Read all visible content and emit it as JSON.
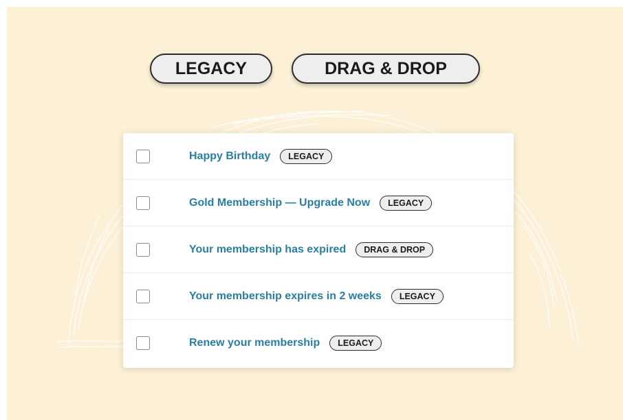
{
  "filters": [
    {
      "label": "LEGACY"
    },
    {
      "label": "DRAG & DROP"
    }
  ],
  "rows": [
    {
      "title": "Happy Birthday",
      "tag": "LEGACY"
    },
    {
      "title": "Gold Membership — Upgrade Now",
      "tag": "LEGACY"
    },
    {
      "title": "Your membership has expired",
      "tag": "DRAG & DROP"
    },
    {
      "title": "Your membership expires in 2 weeks",
      "tag": "LEGACY"
    },
    {
      "title": "Renew your membership",
      "tag": "LEGACY"
    }
  ],
  "colors": {
    "background": "#fcf0d6",
    "link": "#2a7ea0",
    "pill_bg": "#eeeeee",
    "pill_border": "#2b2b2b"
  }
}
